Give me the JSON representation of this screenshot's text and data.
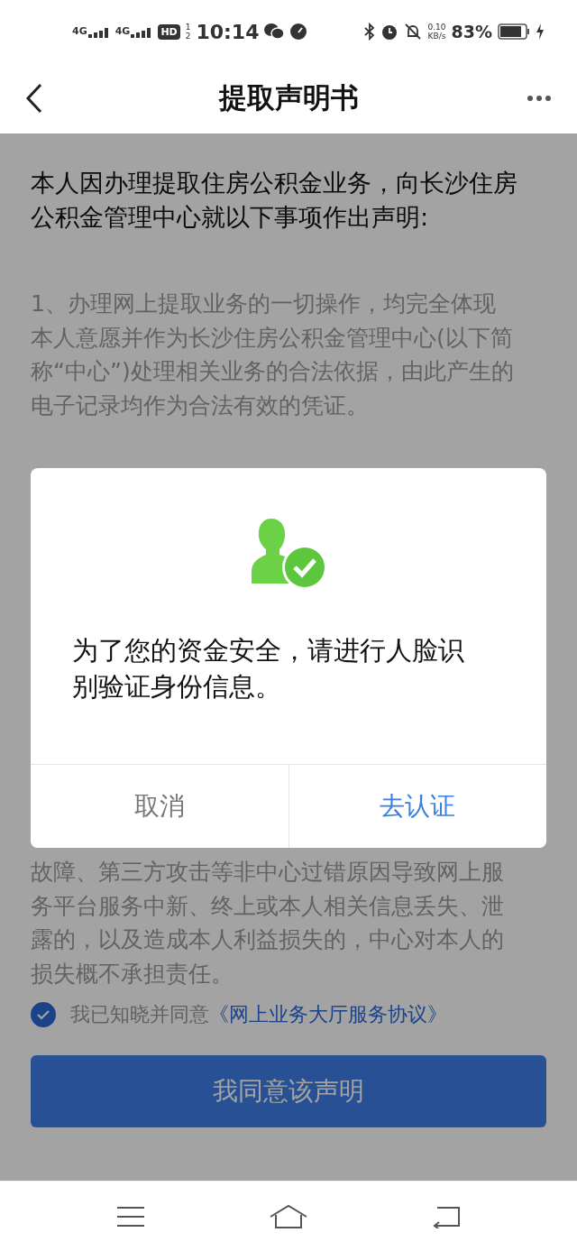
{
  "status_bar": {
    "networks": [
      "4G",
      "4G"
    ],
    "hd_badge": "HD",
    "hd_slots": [
      "1",
      "2"
    ],
    "time": "10:14",
    "speed": [
      "0.10",
      "KB/s"
    ],
    "battery": "83%"
  },
  "nav": {
    "title": "提取声明书"
  },
  "intro": "本人因办理提取住房公积金业务，向长沙住房公积金管理中心就以下事项作出声明:",
  "clauses": [
    "1、办理网上提取业务的一切操作，均完全体现本人意愿并作为长沙住房公积金管理中心(以下简称“中心”)处理相关业务的合法依据，由此产生的电子记录均作为合法有效的凭证。",
    "故障、第三方攻击等非中心过错原因导致网上服务平台服务中新、终上或本人相关信息丢失、泄露的，以及造成本人利益损失的，中心对本人的损失概不承担责任。"
  ],
  "agreement": {
    "checked": true,
    "text": "我已知晓并同意",
    "link": "《网上业务大厅服务协议》"
  },
  "agree_button": "我同意该声明",
  "dialog": {
    "message": "为了您的资金安全，请进行人脸识别验证身份信息。",
    "buttons": [
      {
        "label": "取消",
        "kind": "cancel"
      },
      {
        "label": "去认证",
        "kind": "confirm"
      }
    ]
  }
}
